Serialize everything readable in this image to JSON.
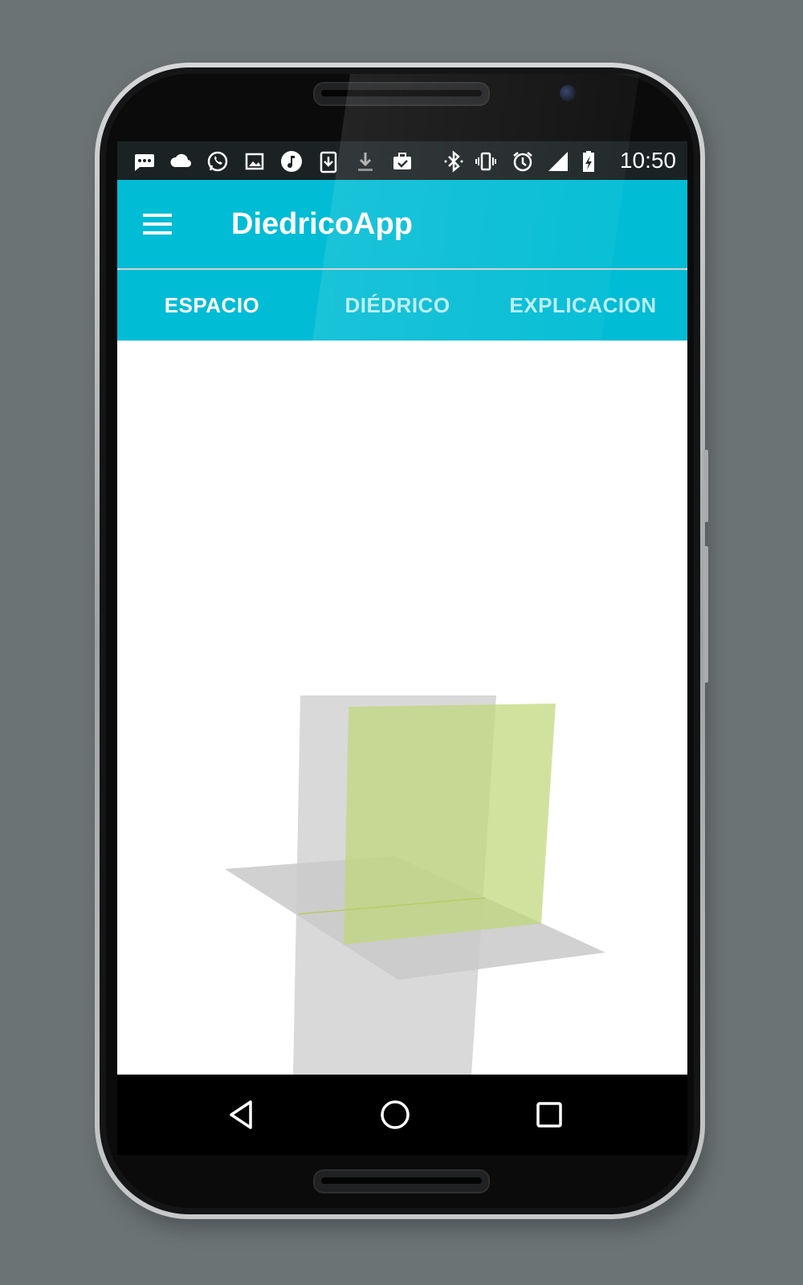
{
  "status_bar": {
    "time": "10:50",
    "icons": [
      "messages-icon",
      "cloud-icon",
      "whatsapp-icon",
      "image-icon",
      "music-icon",
      "download-box-icon",
      "download-icon",
      "briefcase-check-icon",
      "bluetooth-icon",
      "vibrate-icon",
      "alarm-icon",
      "signal-icon",
      "battery-charging-icon"
    ]
  },
  "app_bar": {
    "title": "DiedricoApp",
    "menu_icon": "menu-icon"
  },
  "tabs": [
    {
      "label": "ESPACIO",
      "selected": true
    },
    {
      "label": "DIÉDRICO",
      "selected": false
    },
    {
      "label": "EXPLICACION",
      "selected": false
    }
  ],
  "scene": {
    "description_colors": {
      "grey_plane": "#d6d6d6",
      "green_plane": "#c2d882",
      "background": "#ffffff"
    }
  },
  "nav_bar": {
    "buttons": [
      "back-icon",
      "home-icon",
      "recents-icon"
    ]
  },
  "colors": {
    "accent": "#00bcd4",
    "status_bar": "#1b2224",
    "nav_bar": "#000000",
    "backdrop": "#6b7375"
  }
}
